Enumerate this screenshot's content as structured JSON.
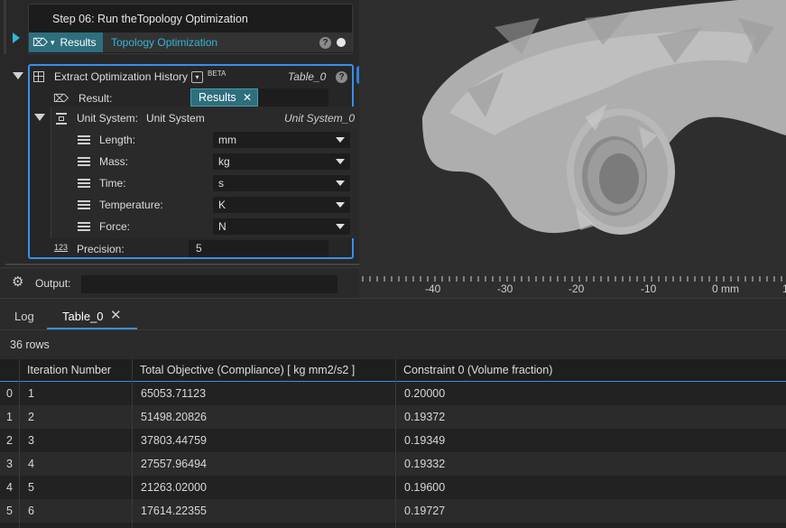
{
  "step": {
    "title": "Step 06: Run theTopology Optimization",
    "results_label": "Results",
    "results_link": "Topology Optimization"
  },
  "extract": {
    "title": "Extract Optimization History",
    "beta": "BETA",
    "table_name": "Table_0",
    "result_label": "Result:",
    "result_chip": "Results",
    "unit_label": "Unit System:",
    "unit_value": "Unit System",
    "unit_name": "Unit System_0",
    "units": [
      {
        "label": "Length:",
        "value": "mm"
      },
      {
        "label": "Mass:",
        "value": "kg"
      },
      {
        "label": "Time:",
        "value": "s"
      },
      {
        "label": "Temperature:",
        "value": "K"
      },
      {
        "label": "Force:",
        "value": "N"
      }
    ],
    "precision_icon": "123",
    "precision_label": "Precision:",
    "precision_value": "5"
  },
  "output": {
    "label": "Output:"
  },
  "ruler": {
    "labels": [
      "-40",
      "-30",
      "-20",
      "-10",
      "0 mm",
      "1"
    ]
  },
  "tabs": [
    {
      "label": "Log"
    },
    {
      "label": "Table_0"
    }
  ],
  "rows_info": "36 rows",
  "table": {
    "columns": [
      "Iteration Number",
      "Total Objective (Compliance) [ kg mm2/s2 ]",
      "Constraint 0 (Volume fraction)"
    ],
    "rows": [
      {
        "idx": "0",
        "iter": "1",
        "obj": "65053.71123",
        "con": "0.20000"
      },
      {
        "idx": "1",
        "iter": "2",
        "obj": "51498.20826",
        "con": "0.19372"
      },
      {
        "idx": "2",
        "iter": "3",
        "obj": "37803.44759",
        "con": "0.19349"
      },
      {
        "idx": "3",
        "iter": "4",
        "obj": "27557.96494",
        "con": "0.19332"
      },
      {
        "idx": "4",
        "iter": "5",
        "obj": "21263.02000",
        "con": "0.19600"
      },
      {
        "idx": "5",
        "iter": "6",
        "obj": "17614.22355",
        "con": "0.19727"
      }
    ]
  },
  "colors": {
    "accent": "#3a8fe8",
    "teal": "#2d6f7d",
    "link": "#33b4d8",
    "stripe": "#2a2a2a"
  }
}
